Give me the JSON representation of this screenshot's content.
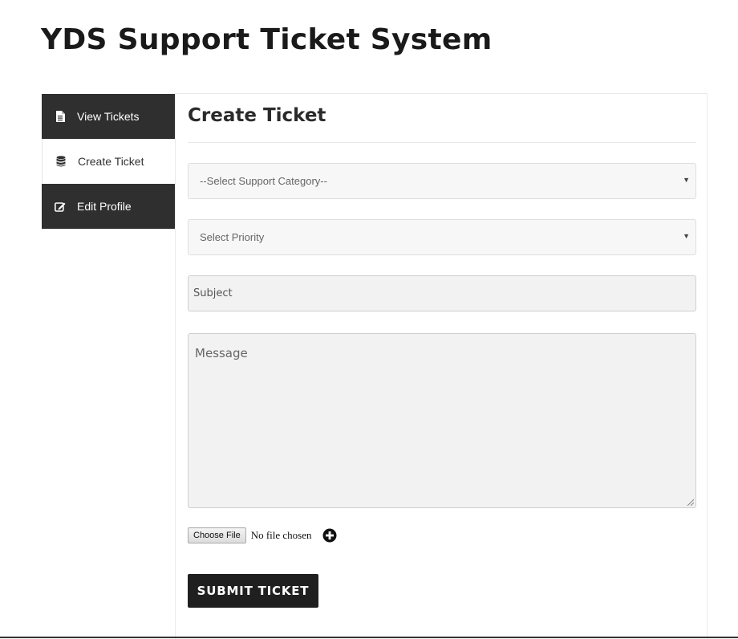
{
  "page": {
    "title": "YDS Support Ticket System"
  },
  "tabs": [
    {
      "label": "View Tickets",
      "icon": "document-icon",
      "active": false
    },
    {
      "label": "Create Ticket",
      "icon": "database-icon",
      "active": true
    },
    {
      "label": "Edit Profile",
      "icon": "edit-icon",
      "active": false
    }
  ],
  "form": {
    "heading": "Create Ticket",
    "category": {
      "selected": "--Select Support Category--"
    },
    "priority": {
      "selected": "Select Priority"
    },
    "subject": {
      "placeholder": "Subject"
    },
    "message": {
      "placeholder": "Message"
    },
    "file": {
      "button_label": "Choose File",
      "status": "No file chosen",
      "add_icon": "plus-circle-icon"
    },
    "submit_label": "SUBMIT TICKET"
  },
  "colors": {
    "tab_dark": "#2f2f2f",
    "button_dark": "#1f1f1f",
    "field_bg": "#f7f7f7"
  }
}
